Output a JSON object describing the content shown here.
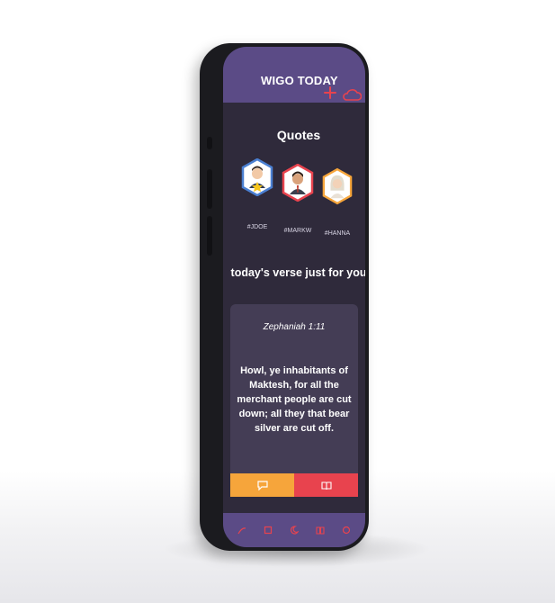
{
  "app": {
    "title": "WIGO TODAY"
  },
  "quotes": {
    "heading": "Quotes",
    "people": [
      {
        "handle": "#JDOE",
        "border": "#4a7fd1",
        "badge": "star"
      },
      {
        "handle": "#MARKW",
        "border": "#e8434e"
      },
      {
        "handle": "#HANNA",
        "border": "#f6a53b"
      }
    ]
  },
  "verse": {
    "heading": "today's verse just for you",
    "reference": "Zephaniah 1:11",
    "text": "Howl, ye inhabitants of Maktesh, for all the merchant people are cut down; all they that bear silver are cut off."
  },
  "colors": {
    "accent_red": "#e8434e",
    "accent_orange": "#f6a53b",
    "header_purple": "#5b4b86",
    "screen_bg": "#2f2a3b",
    "card_bg": "#443d55"
  },
  "icons": {
    "header_add": "plus-icon",
    "header_cloud": "cloud-icon",
    "comment_button": "speech-bubble-icon",
    "read_button": "book-icon",
    "nav": [
      "bookmark-icon",
      "book-icon",
      "moon-icon",
      "book-open-icon",
      "circle-icon"
    ]
  }
}
